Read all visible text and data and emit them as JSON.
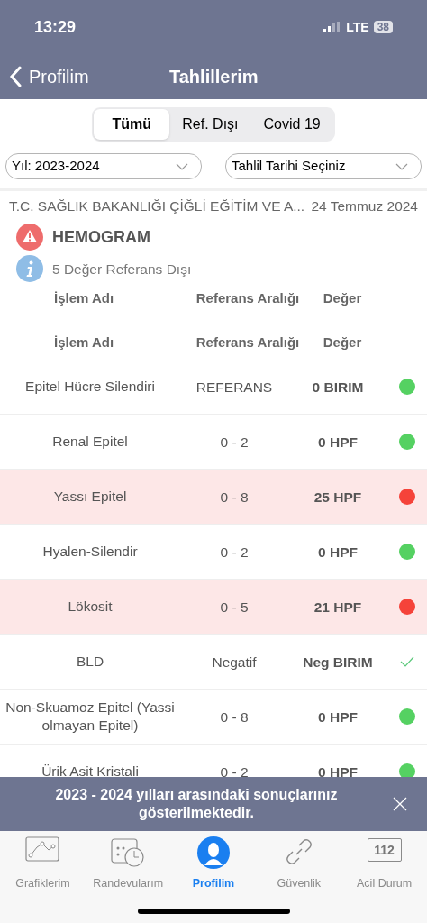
{
  "status_bar": {
    "time": "13:29",
    "network": "LTE",
    "battery": "38"
  },
  "nav": {
    "back_label": "Profilim",
    "title": "Tahlillerim"
  },
  "segments": [
    {
      "label": "Tümü",
      "selected": true
    },
    {
      "label": "Ref. Dışı",
      "selected": false
    },
    {
      "label": "Covid 19",
      "selected": false
    }
  ],
  "filters": [
    {
      "value": "Yıl: 2023-2024"
    },
    {
      "value": "Tahlil Tarihi Seçiniz"
    }
  ],
  "report": {
    "institution": "T.C. SAĞLIK BAKANLIĞI ÇİĞLİ EĞİTİM VE A...",
    "date": "24 Temmuz 2024",
    "test_name": "HEMOGRAM",
    "out_of_range_note": "5 Değer Referans Dışı"
  },
  "column_headers": [
    [
      "İşlem Adı",
      "Referans Aralığı",
      "Değer"
    ],
    [
      "İşlem Adı",
      "Referans Aralığı",
      "Değer"
    ]
  ],
  "rows": [
    {
      "name": "Epitel Hücre Silendiri",
      "reference": "REFERANS",
      "value": "0 BIRIM",
      "kind": "normal"
    },
    {
      "name": "Renal Epitel",
      "reference": "0 - 2",
      "value": "0 HPF",
      "kind": "normal"
    },
    {
      "name": "Yassı Epitel",
      "reference": "0 - 8",
      "value": "25 HPF",
      "kind": "abnormal"
    },
    {
      "name": "Hyalen-Silendir",
      "reference": "0 - 2",
      "value": "0 HPF",
      "kind": "normal"
    },
    {
      "name": "Lökosit",
      "reference": "0 - 5",
      "value": "21 HPF",
      "kind": "abnormal"
    },
    {
      "name": "BLD",
      "reference": "Negatif",
      "value": "Neg BIRIM",
      "kind": "check"
    },
    {
      "name": "Non-Skuamoz Epitel (Yassi olmayan Epitel)",
      "reference": "0 - 8",
      "value": "0 HPF",
      "kind": "normal"
    },
    {
      "name": "Ürik Asit Kristali",
      "reference": "0 - 2",
      "value": "0 HPF",
      "kind": "normal"
    }
  ],
  "banner": {
    "message": "2023 - 2024 yılları arasındaki sonuçlarınız gösterilmektedir."
  },
  "tab_bar": [
    {
      "label": "Grafiklerim",
      "kind": "chart",
      "selected": false
    },
    {
      "label": "Randevularım",
      "kind": "calendar",
      "selected": false
    },
    {
      "label": "Profilim",
      "kind": "person",
      "selected": true
    },
    {
      "label": "Güvenlik",
      "kind": "link",
      "selected": false
    },
    {
      "label": "Acil Durum",
      "kind": "badge",
      "badge_text": "112",
      "selected": false
    }
  ]
}
